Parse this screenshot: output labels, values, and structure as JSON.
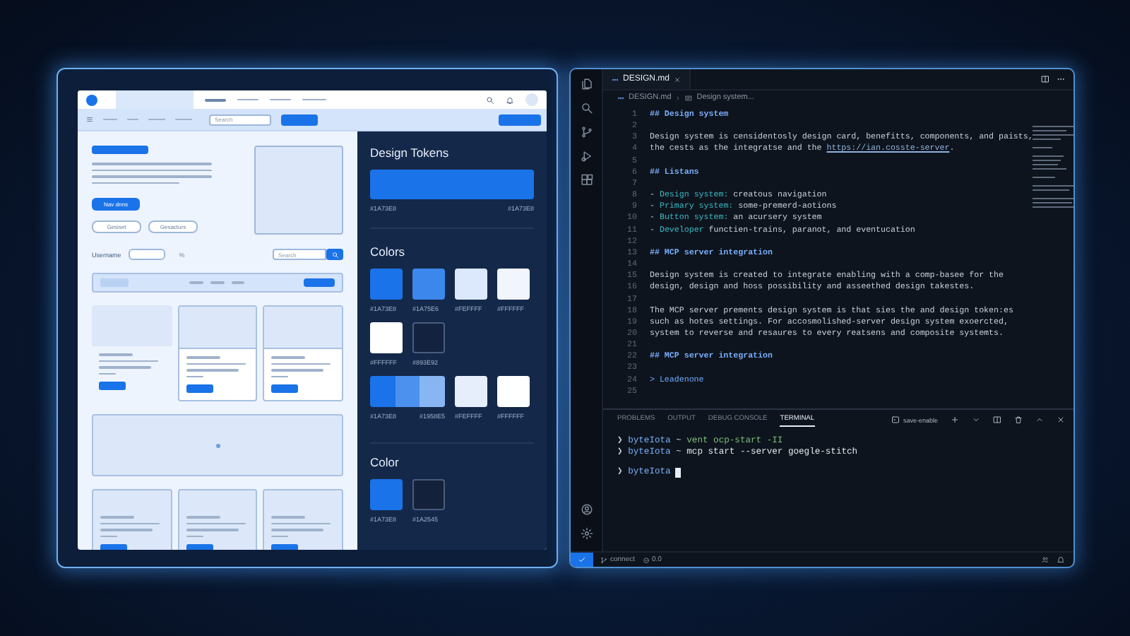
{
  "wireframe": {
    "nav_search": {
      "placeholder": "Search"
    },
    "hero": {
      "primary_button": "Nav dnns",
      "buttons": [
        "Gesiset",
        "Gesacturs"
      ]
    },
    "form": {
      "label": "Username",
      "symbol": "%",
      "search": {
        "placeholder": "Search"
      }
    }
  },
  "tokens": {
    "title": "Design Tokens",
    "bar": {
      "color": "#1A73E8",
      "labels": [
        "#1A73E8",
        "#1A73E8"
      ]
    },
    "colors_title": "Colors",
    "swatch_rows": [
      [
        {
          "kind": "solid",
          "color": "#1A73E8",
          "label": "#1A73E8"
        },
        {
          "kind": "solid",
          "color": "#3B87EC",
          "label": "#1A75E6"
        },
        {
          "kind": "solid",
          "color": "#DCE8FB",
          "label": "#FEFFFF"
        },
        {
          "kind": "solid",
          "color": "#F1F5FC",
          "label": "#FFFFFF"
        }
      ],
      [
        {
          "kind": "solid",
          "color": "#FFFFFF",
          "label": "#FFFFFF"
        },
        {
          "kind": "outline",
          "color": "#13233F",
          "label": "#893E92"
        }
      ],
      [
        {
          "kind": "strip",
          "color": "#1A73E8",
          "labels": [
            "#1A73E8",
            "#1958E5"
          ]
        },
        {
          "kind": "solid",
          "color": "#E6EEFB",
          "label": "#FEFFFF"
        },
        {
          "kind": "solid",
          "color": "#FFFFFF",
          "label": "#FFFFFF"
        }
      ]
    ],
    "color_title": "Color",
    "color_swatches": [
      {
        "kind": "solid",
        "color": "#1A73E8",
        "label": "#1A73E8"
      },
      {
        "kind": "outline",
        "color": "#14213A",
        "label": "#1A2545"
      }
    ]
  },
  "editor": {
    "tab": "DESIGN.md",
    "breadcrumb": [
      "DESIGN.md",
      "Design system..."
    ],
    "lines": [
      {
        "number": "1",
        "segments": [
          {
            "kind": "heading",
            "text": "## Design system"
          }
        ]
      },
      {
        "number": "2"
      },
      {
        "number": "3",
        "segments": [
          {
            "kind": "text",
            "text": "Design system is censidentosly design card, benefitts, components, and paists,"
          }
        ]
      },
      {
        "number": "4",
        "segments": [
          {
            "kind": "text",
            "text": "the cests as the integratse and the "
          },
          {
            "kind": "link",
            "text": "https://ian.cosste-server"
          },
          {
            "kind": "text",
            "text": "."
          }
        ]
      },
      {
        "number": "5"
      },
      {
        "number": "6",
        "segments": [
          {
            "kind": "heading",
            "text": "## Listans"
          }
        ]
      },
      {
        "number": "7"
      },
      {
        "number": "8",
        "segments": [
          {
            "kind": "text",
            "text": "- "
          },
          {
            "kind": "key",
            "text": "Design system:"
          },
          {
            "kind": "text",
            "text": " creatous navigation"
          }
        ]
      },
      {
        "number": "9",
        "segments": [
          {
            "kind": "text",
            "text": "- "
          },
          {
            "kind": "key",
            "text": "Primary system:"
          },
          {
            "kind": "text",
            "text": " some-premerd-aotions"
          }
        ]
      },
      {
        "number": "10",
        "segments": [
          {
            "kind": "text",
            "text": "- "
          },
          {
            "kind": "key",
            "text": "Button system:"
          },
          {
            "kind": "text",
            "text": " an acursery system"
          }
        ]
      },
      {
        "number": "11",
        "segments": [
          {
            "kind": "text",
            "text": "- "
          },
          {
            "kind": "key",
            "text": "Developer"
          },
          {
            "kind": "text",
            "text": " functien-trains, paranot, and eventucation"
          }
        ]
      },
      {
        "number": "12"
      },
      {
        "number": "13",
        "segments": [
          {
            "kind": "heading",
            "text": "## MCP server integration"
          }
        ]
      },
      {
        "number": "14"
      },
      {
        "number": "15",
        "segments": [
          {
            "kind": "text",
            "text": "Design system is created to integrate enabling with a comp-basee for the"
          }
        ]
      },
      {
        "number": "16",
        "segments": [
          {
            "kind": "text",
            "text": "design, design and hoss possibility and asseethed design takestes."
          }
        ]
      },
      {
        "number": "17"
      },
      {
        "number": "18",
        "segments": [
          {
            "kind": "text",
            "text": "The MCP server prements design system is that sies the and design token:es"
          }
        ]
      },
      {
        "number": "19",
        "segments": [
          {
            "kind": "text",
            "text": "such as hotes settings. For accosmolished-server design system exoercted,"
          }
        ]
      },
      {
        "number": "20",
        "segments": [
          {
            "kind": "text",
            "text": "system to reverse and resaures to every reatsens and composite systemts."
          }
        ]
      },
      {
        "number": "21"
      },
      {
        "number": "22",
        "segments": [
          {
            "kind": "heading",
            "text": "## MCP server integration"
          }
        ]
      },
      {
        "number": "23"
      },
      {
        "number": "24",
        "segments": [
          {
            "kind": "quote",
            "text": "> Leadenone"
          }
        ]
      },
      {
        "number": "25"
      }
    ],
    "panel": {
      "tabs": [
        {
          "label": "PROBLEMS",
          "selected": false
        },
        {
          "label": "OUTPUT",
          "selected": false
        },
        {
          "label": "DEBUG CONSOLE",
          "selected": false
        },
        {
          "label": "TERMINAL",
          "selected": true
        }
      ],
      "task": "save-enable",
      "terminal": [
        {
          "segments": [
            {
              "kind": "prompt",
              "text": "❯ "
            },
            {
              "kind": "user",
              "text": "byteIota"
            },
            {
              "kind": "prompt",
              "text": " ~ "
            },
            {
              "kind": "arg",
              "text": "vent ocp-start -II"
            }
          ],
          "cursor": false
        },
        {
          "segments": [
            {
              "kind": "prompt",
              "text": "❯ "
            },
            {
              "kind": "user",
              "text": "byteIota"
            },
            {
              "kind": "prompt",
              "text": " ~ "
            },
            {
              "kind": "command",
              "text": "mcp start --server goegle-stitch"
            }
          ],
          "cursor": false
        },
        {
          "segments": [
            {
              "kind": "prompt",
              "text": "❯ "
            },
            {
              "kind": "user",
              "text": "byteIota"
            }
          ],
          "cursor": true
        }
      ]
    },
    "status_bar": {
      "branch": "connect",
      "problems": "0.0"
    }
  }
}
